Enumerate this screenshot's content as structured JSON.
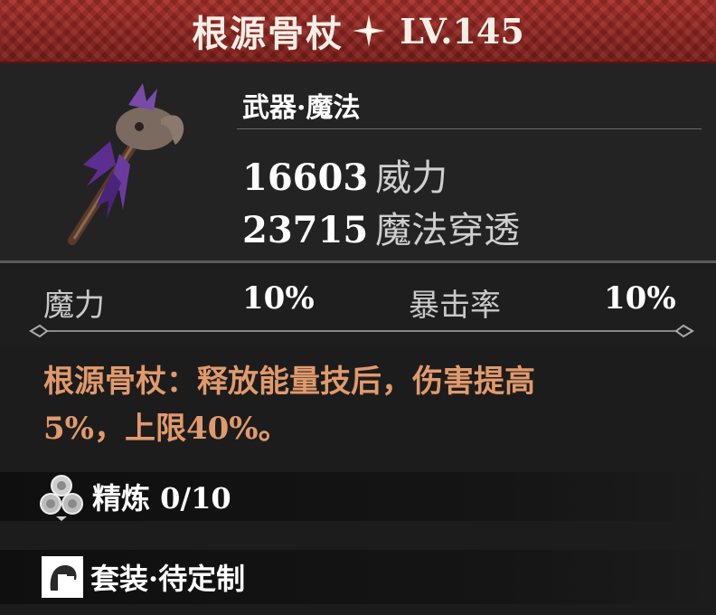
{
  "header": {
    "title": "根源骨杖",
    "level": "LV.145",
    "colors": {
      "banner": "#8f2621",
      "title_text": "#f5efe6"
    }
  },
  "item": {
    "category": "武器·魔法",
    "icon": "bone-staff-icon",
    "stats": [
      {
        "value": "16603",
        "label": "威力"
      },
      {
        "value": "23715",
        "label": "魔法穿透"
      }
    ]
  },
  "substats": [
    {
      "label": "魔力",
      "value": "10%"
    },
    {
      "label": "暴击率",
      "value": "10%"
    }
  ],
  "effect": {
    "line1": "根源骨杖：释放能量技后，伤害提高",
    "line2": "5%，上限40%。",
    "color": "#e19a6c"
  },
  "refine": {
    "icon": "refine-icon",
    "label": "精炼 0/10"
  },
  "set": {
    "icon": "set-armor-icon",
    "label": "套装·待定制"
  }
}
